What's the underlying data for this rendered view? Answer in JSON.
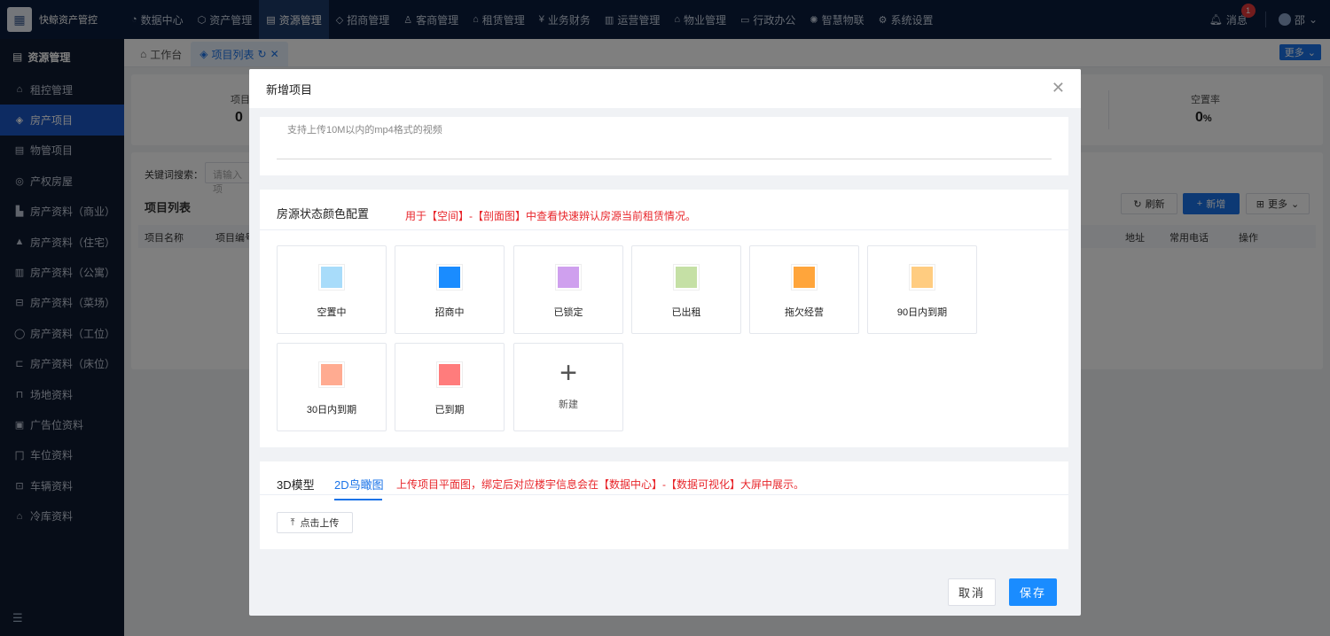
{
  "app": {
    "title": "快鲸资产管控"
  },
  "nav": [
    {
      "label": "数据中心",
      "icon": "dashboard-icon"
    },
    {
      "label": "资产管理",
      "icon": "cube-icon"
    },
    {
      "label": "资源管理",
      "icon": "document-icon",
      "active": true
    },
    {
      "label": "招商管理",
      "icon": "tag-icon"
    },
    {
      "label": "客商管理",
      "icon": "users-icon"
    },
    {
      "label": "租赁管理",
      "icon": "building-icon"
    },
    {
      "label": "业务财务",
      "icon": "money-icon"
    },
    {
      "label": "运营管理",
      "icon": "chart-icon"
    },
    {
      "label": "物业管理",
      "icon": "home-icon"
    },
    {
      "label": "行政办公",
      "icon": "desk-icon"
    },
    {
      "label": "智慧物联",
      "icon": "sun-icon"
    },
    {
      "label": "系统设置",
      "icon": "gear-icon"
    }
  ],
  "header": {
    "messages_label": "消息",
    "messages_badge": "1",
    "user_name": "邵"
  },
  "sidebar": {
    "title": "资源管理",
    "items": [
      {
        "label": "租控管理"
      },
      {
        "label": "房产项目",
        "active": true
      },
      {
        "label": "物管项目"
      },
      {
        "label": "产权房屋"
      },
      {
        "label": "房产资料（商业）"
      },
      {
        "label": "房产资料（住宅）"
      },
      {
        "label": "房产资料（公寓）"
      },
      {
        "label": "房产资料（菜场）"
      },
      {
        "label": "房产资料（工位）"
      },
      {
        "label": "房产资料（床位）"
      },
      {
        "label": "场地资料"
      },
      {
        "label": "广告位资料"
      },
      {
        "label": "车位资料"
      },
      {
        "label": "车辆资料"
      },
      {
        "label": "冷库资料"
      }
    ]
  },
  "tabs": [
    {
      "label": "工作台"
    },
    {
      "label": "项目列表",
      "active": true
    }
  ],
  "tabs_more_label": "更多",
  "background": {
    "stat_left_label": "项目",
    "stat_left_value": "0",
    "stat_right_label": "空置率",
    "stat_right_value": "0",
    "stat_right_unit": "%",
    "search_label": "关键词搜索：",
    "search_placeholder": "请输入项",
    "list_title": "项目列表",
    "refresh_label": "刷新",
    "add_label": "新增",
    "more_label": "更多",
    "columns_left": [
      "项目名称",
      "项目编号"
    ],
    "columns_right": [
      "地址",
      "常用电话",
      "操作"
    ]
  },
  "modal": {
    "title": "新增项目",
    "video_hint": "支持上传10M以内的mp4格式的视频",
    "color_config_title": "房源状态颜色配置",
    "color_config_note": "用于【空间】-【剖面图】中查看快速辨认房源当前租赁情况。",
    "statuses": [
      {
        "label": "空置中",
        "color": "#a8dcfa"
      },
      {
        "label": "招商中",
        "color": "#1a8cff"
      },
      {
        "label": "已锁定",
        "color": "#cfa0ee"
      },
      {
        "label": "已出租",
        "color": "#c5e0a5"
      },
      {
        "label": "拖欠经营",
        "color": "#ffa53b"
      },
      {
        "label": "90日内到期",
        "color": "#ffcc80"
      },
      {
        "label": "30日内到期",
        "color": "#ffab91"
      },
      {
        "label": "已到期",
        "color": "#ff7c7c"
      }
    ],
    "new_label": "新建",
    "model_tabs": [
      {
        "label": "3D模型"
      },
      {
        "label": "2D鸟瞰图",
        "active": true
      }
    ],
    "model_note": "上传项目平面图，绑定后对应楼宇信息会在【数据中心】-【数据可视化】大屏中展示。",
    "upload_label": "点击上传",
    "cancel_label": "取消",
    "save_label": "保存"
  }
}
